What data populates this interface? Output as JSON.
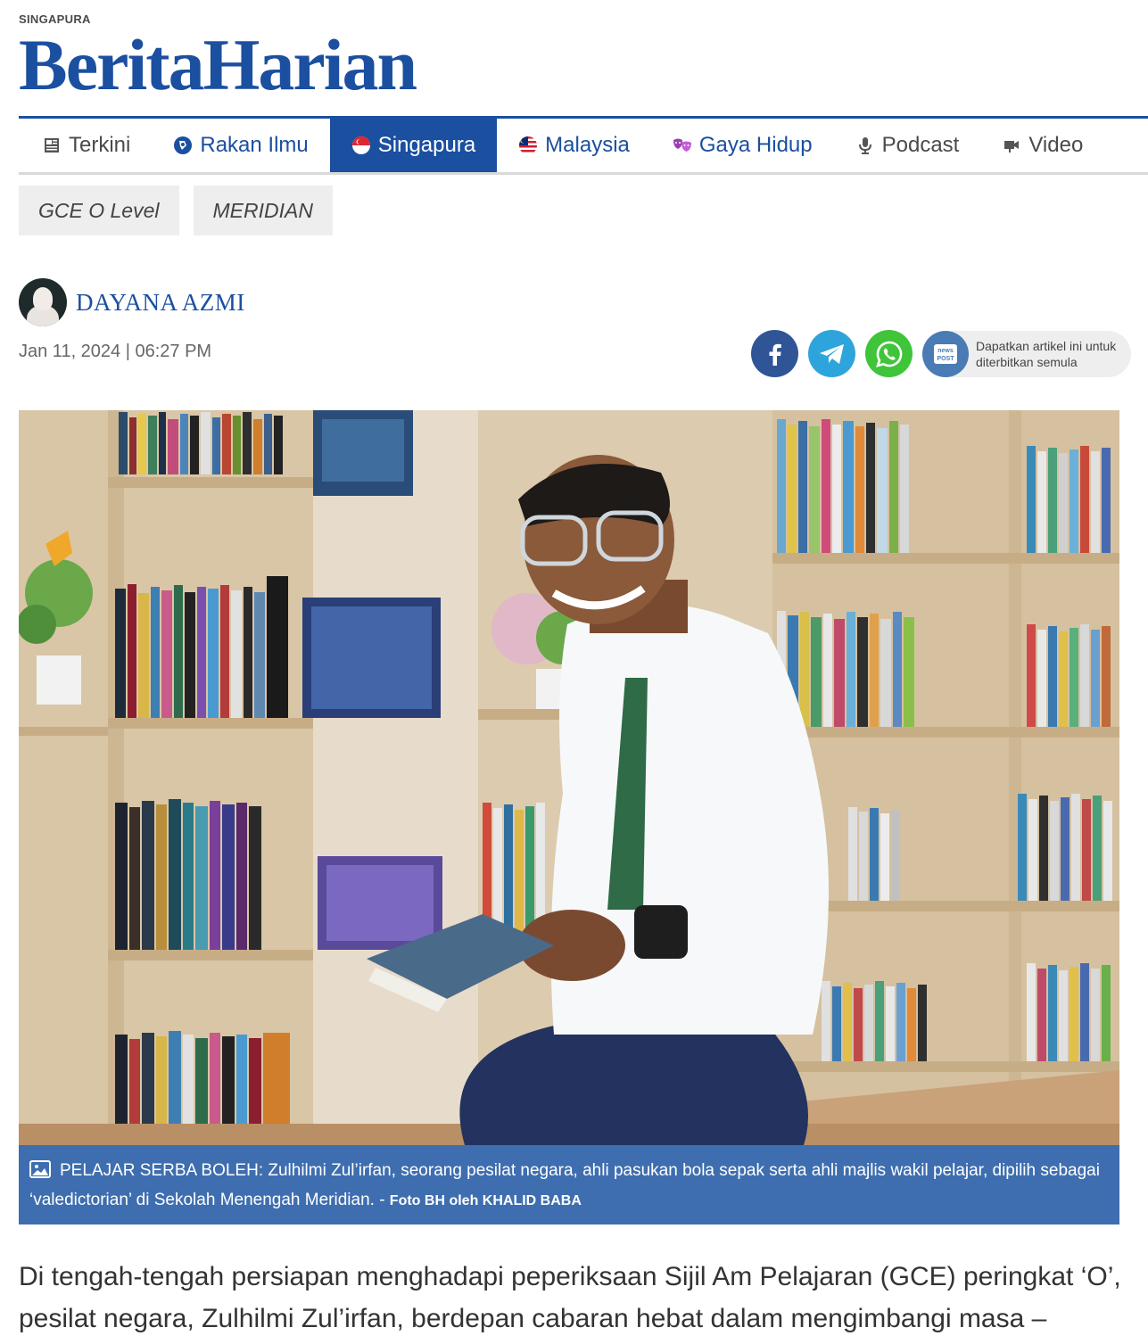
{
  "header": {
    "section_kicker": "SINGAPURA",
    "brand": "BeritaHarian"
  },
  "nav": {
    "items": [
      {
        "label": "Terkini",
        "icon": "newspaper-icon"
      },
      {
        "label": "Rakan Ilmu",
        "icon": "rakan-ilmu-icon"
      },
      {
        "label": "Singapura",
        "icon": "singapore-flag-icon",
        "active": true
      },
      {
        "label": "Malaysia",
        "icon": "malaysia-flag-icon"
      },
      {
        "label": "Gaya Hidup",
        "icon": "theatre-masks-icon"
      },
      {
        "label": "Podcast",
        "icon": "microphone-icon"
      },
      {
        "label": "Video",
        "icon": "video-camera-icon"
      }
    ]
  },
  "tags": [
    "GCE O Level",
    "MERIDIAN"
  ],
  "article": {
    "author": "DAYANA AZMI",
    "dateline": "Jan 11, 2024 | 06:27 PM",
    "caption": "PELAJAR SERBA BOLEH: Zulhilmi Zul’irfan, seorang pesilat negara, ahli pasukan bola sepak serta ahli majlis wakil pelajar, dipilih sebagai ‘valedictorian’ di Sekolah Menengah Meridian. - ",
    "caption_credit": "Foto BH oleh KHALID BABA",
    "lead": "Di tengah-tengah persiapan menghadapi peperiksaan Sijil Am Pelajaran (GCE) peringkat ‘O’, pesilat negara, Zulhilmi Zul’irfan, berdepan cabaran hebat dalam mengimbangi masa –"
  },
  "share": {
    "newspost_label": "Dapatkan artikel ini untuk diterbitkan semula",
    "icons": [
      "facebook-icon",
      "telegram-icon",
      "whatsapp-icon",
      "newspost-icon"
    ]
  },
  "colors": {
    "brand_blue": "#1b4fa0",
    "caption_bg": "#3e6eaf",
    "facebook": "#2f5596",
    "telegram": "#2da5dc",
    "whatsapp": "#3fc43a"
  }
}
